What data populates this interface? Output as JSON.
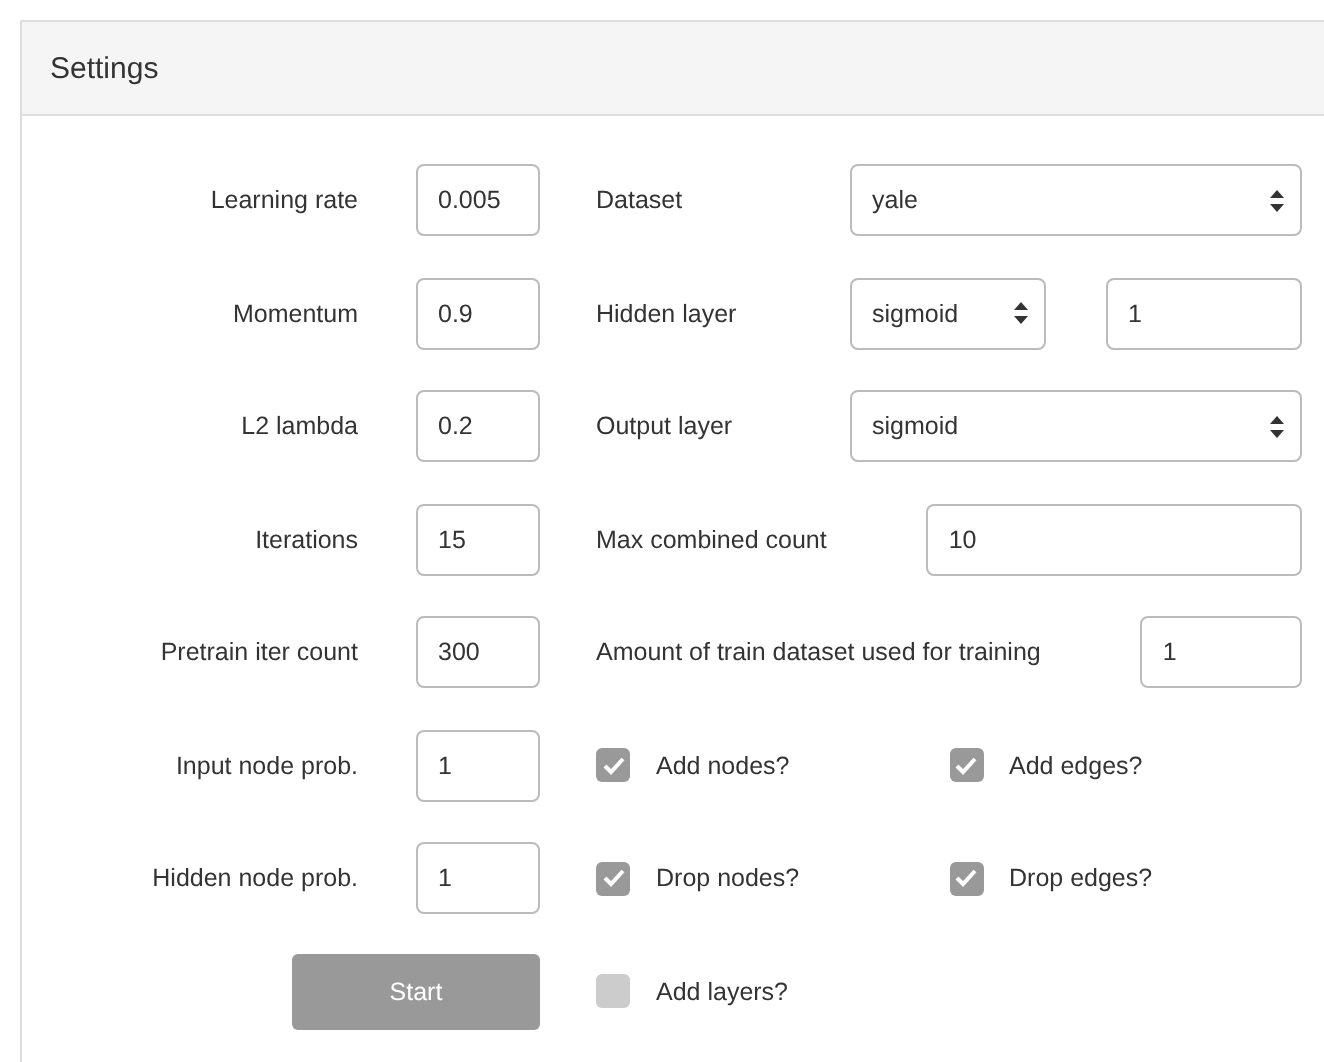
{
  "panel": {
    "title": "Settings"
  },
  "fields": [
    {
      "label": "Learning rate",
      "value": "0.005"
    },
    {
      "label": "Momentum",
      "value": "0.9"
    },
    {
      "label": "L2 lambda",
      "value": "0.2"
    },
    {
      "label": "Iterations",
      "value": "15"
    },
    {
      "label": "Pretrain iter count",
      "value": "300"
    },
    {
      "label": "Input node prob.",
      "value": "1"
    },
    {
      "label": "Hidden node prob.",
      "value": "1"
    }
  ],
  "start_button": {
    "label": "Start",
    "disabled": true
  },
  "options": [
    {
      "kind": "select",
      "label": "Dataset",
      "value": "yale"
    },
    {
      "kind": "select_input",
      "label": "Hidden layer",
      "value": "sigmoid",
      "count": "1"
    },
    {
      "kind": "select",
      "label": "Output layer",
      "value": "sigmoid"
    },
    {
      "kind": "input",
      "label": "Max combined count",
      "value": "10"
    },
    {
      "kind": "input",
      "label": "Amount of train dataset used for training",
      "value": "1"
    },
    {
      "kind": "checks",
      "items": [
        {
          "label": "Add nodes?",
          "checked": true
        },
        {
          "label": "Add edges?",
          "checked": true
        }
      ]
    },
    {
      "kind": "checks",
      "items": [
        {
          "label": "Drop nodes?",
          "checked": true
        },
        {
          "label": "Drop edges?",
          "checked": true
        }
      ]
    },
    {
      "kind": "checks",
      "items": [
        {
          "label": "Add layers?",
          "checked": false
        }
      ]
    }
  ]
}
